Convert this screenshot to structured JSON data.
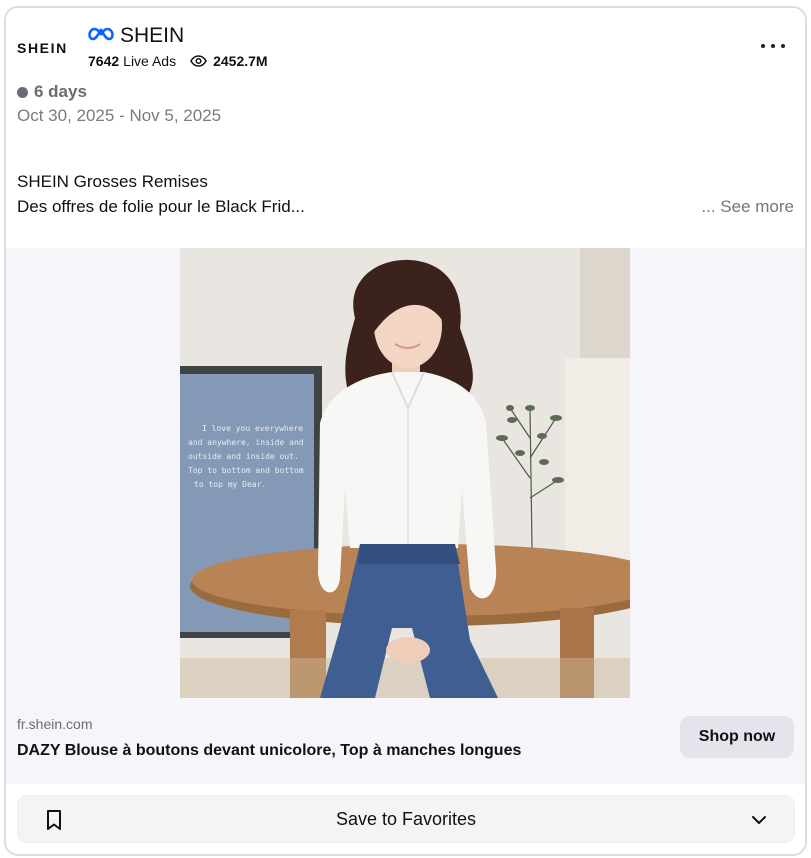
{
  "advertiser": {
    "logo_text": "SHEIN",
    "name": "SHEIN",
    "live_ads_count": "7642",
    "live_ads_label": "Live Ads",
    "views": "2452.7M"
  },
  "status": {
    "duration": "6 days",
    "date_range": "Oct 30, 2025 - Nov 5, 2025",
    "dot_color": "#6b6b78"
  },
  "ad_copy": {
    "title": "SHEIN Grosses Remises",
    "body": "Des offres de folie pour le Black Frid...",
    "see_more": "... See more"
  },
  "media": {
    "artwork_text": [
      "I love you everywhere",
      "and anywhere, inside and",
      "outside and inside out.",
      "Top to bottom and bottom",
      "to top my Dear."
    ]
  },
  "link": {
    "domain": "fr.shein.com",
    "product_title": "DAZY Blouse à boutons devant unicolore, Top à manches longues",
    "cta_label": "Shop now"
  },
  "actions": {
    "save_label": "Save to Favorites"
  },
  "icons": {
    "platform": "meta-icon",
    "views": "eye-icon",
    "more": "more-icon",
    "bookmark": "bookmark-icon",
    "dropdown": "chevron-down-icon"
  },
  "colors": {
    "meta_blue": "#0866ff",
    "card_border": "#dcdde3",
    "muted_text": "#7a7a82",
    "cta_bg": "#e3e4ec"
  }
}
